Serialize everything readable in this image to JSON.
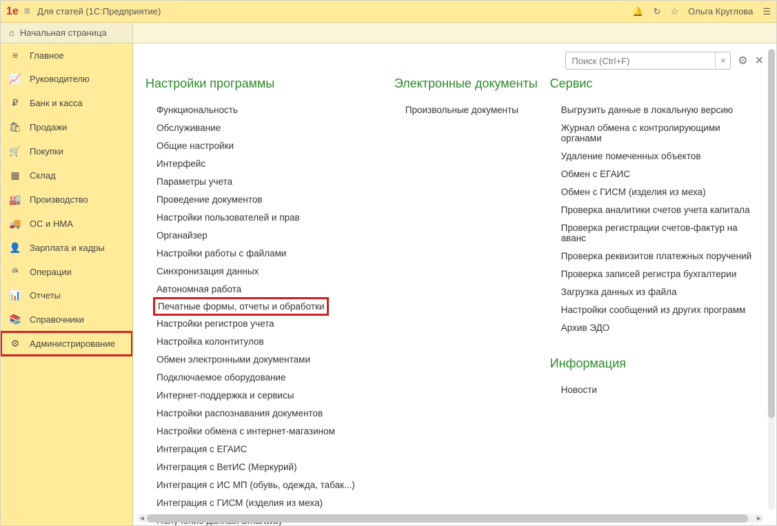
{
  "titlebar": {
    "logo": "1e",
    "title": "Для статей  (1С:Предприятие)",
    "user": "Ольга Круглова"
  },
  "homebar": {
    "home_label": "Начальная страница"
  },
  "search": {
    "placeholder": "Поиск (Ctrl+F)",
    "clear": "×"
  },
  "sidebar": {
    "items": [
      {
        "icon": "≡",
        "label": "Главное"
      },
      {
        "icon": "📈",
        "label": "Руководителю"
      },
      {
        "icon": "₽",
        "label": "Банк и касса"
      },
      {
        "icon": "🛍",
        "label": "Продажи"
      },
      {
        "icon": "🛒",
        "label": "Покупки"
      },
      {
        "icon": "▦",
        "label": "Склад"
      },
      {
        "icon": "🏭",
        "label": "Производство"
      },
      {
        "icon": "🚚",
        "label": "ОС и НМА"
      },
      {
        "icon": "👤",
        "label": "Зарплата и кадры"
      },
      {
        "icon": "ᵈᵏ",
        "label": "Операции"
      },
      {
        "icon": "📊",
        "label": "Отчеты"
      },
      {
        "icon": "📚",
        "label": "Справочники"
      },
      {
        "icon": "⚙",
        "label": "Администрирование",
        "highlighted": true
      }
    ]
  },
  "columns": {
    "col1": {
      "heading": "Настройки программы",
      "links": [
        "Функциональность",
        "Обслуживание",
        "Общие настройки",
        "Интерфейс",
        "Параметры учета",
        "Проведение документов",
        "Настройки пользователей и прав",
        "Органайзер",
        "Настройки работы с файлами",
        "Синхронизация данных",
        "Автономная работа",
        "Печатные формы, отчеты и обработки",
        "Настройки регистров учета",
        "Настройка колонтитулов",
        "Обмен электронными документами",
        "Подключаемое оборудование",
        "Интернет-поддержка и сервисы",
        "Настройки распознавания документов",
        "Настройки обмена с интернет-магазином",
        "Интеграция с ЕГАИС",
        "Интеграция с ВетИС (Меркурий)",
        "Интеграция с ИС МП (обувь, одежда, табак...)",
        "Интеграция с ГИСМ (изделия из меха)",
        "Получение данных Smartway"
      ],
      "highlighted_index": 11
    },
    "col2": {
      "heading": "Электронные документы",
      "links": [
        "Произвольные документы"
      ]
    },
    "col3": {
      "heading": "Сервис",
      "links": [
        "Выгрузить данные в локальную версию",
        "Журнал обмена с контролирующими органами",
        "Удаление помеченных объектов",
        "Обмен с ЕГАИС",
        "Обмен с ГИСМ (изделия из меха)",
        "Проверка аналитики счетов учета капитала",
        "Проверка регистрации счетов-фактур на аванс",
        "Проверка реквизитов платежных поручений",
        "Проверка записей регистра бухгалтерии",
        "Загрузка данных из файла",
        "Настройки сообщений из других программ",
        "Архив ЭДО"
      ],
      "heading2": "Информация",
      "links2": [
        "Новости"
      ]
    }
  }
}
